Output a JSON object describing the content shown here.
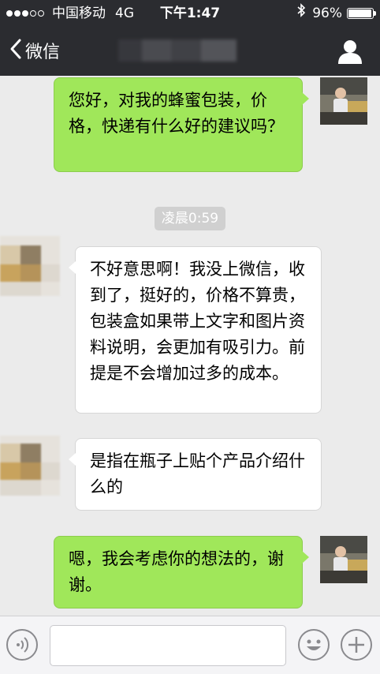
{
  "status_bar": {
    "carrier": "中国移动",
    "network": "4G",
    "time": "下午1:47",
    "battery": "96%",
    "battery_level": 0.96,
    "signal_filled": 3,
    "signal_total": 5
  },
  "nav": {
    "back_label": "微信"
  },
  "messages": [
    {
      "from": "me",
      "text": "您好，对我的蜂蜜包装，价格，快递有什么好的建议吗？"
    },
    {
      "type": "timestamp",
      "text": "凌晨0:59"
    },
    {
      "from": "other",
      "text": "不好意思啊！我没上微信，收到了，挺好的，价格不算贵，包装盒如果带上文字和图片资料说明，会更加有吸引力。前提是不会增加过多的成本。"
    },
    {
      "from": "other",
      "text": "是指在瓶子上贴个产品介绍什么的"
    },
    {
      "from": "me",
      "text": "嗯，我会考虑你的想法的，谢谢。"
    }
  ],
  "colors": {
    "nav_bg": "#2b2c30",
    "bubble_me": "#a0e75a",
    "bubble_other": "#ffffff",
    "chat_bg": "#ebebeb"
  },
  "icons": [
    "back-chevron-icon",
    "person-icon",
    "voice-icon",
    "emoji-icon",
    "plus-icon",
    "bluetooth-icon"
  ]
}
